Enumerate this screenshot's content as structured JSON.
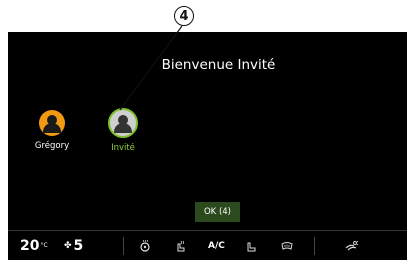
{
  "callout": {
    "number": "4"
  },
  "screen": {
    "title": "Bienvenue Invité",
    "profiles": [
      {
        "name": "Grégory",
        "icon": "user-icon",
        "color": "#f29a12"
      },
      {
        "name": "Invité",
        "icon": "user-icon",
        "color": "#cfcfcf",
        "selected": true,
        "selected_color": "#8fd13a"
      }
    ],
    "ok_button": "OK (4)"
  },
  "climate": {
    "temperature": "20",
    "temperature_unit": "°C",
    "fan_speed": "5",
    "icons": [
      "steering-heat-icon",
      "seat-heat-icon",
      "ac-icon",
      "seat-ventilation-icon",
      "rear-defrost-icon",
      "airflow-icon"
    ],
    "ac_label": "A/C",
    "accent_color": "#7fbf2a"
  }
}
